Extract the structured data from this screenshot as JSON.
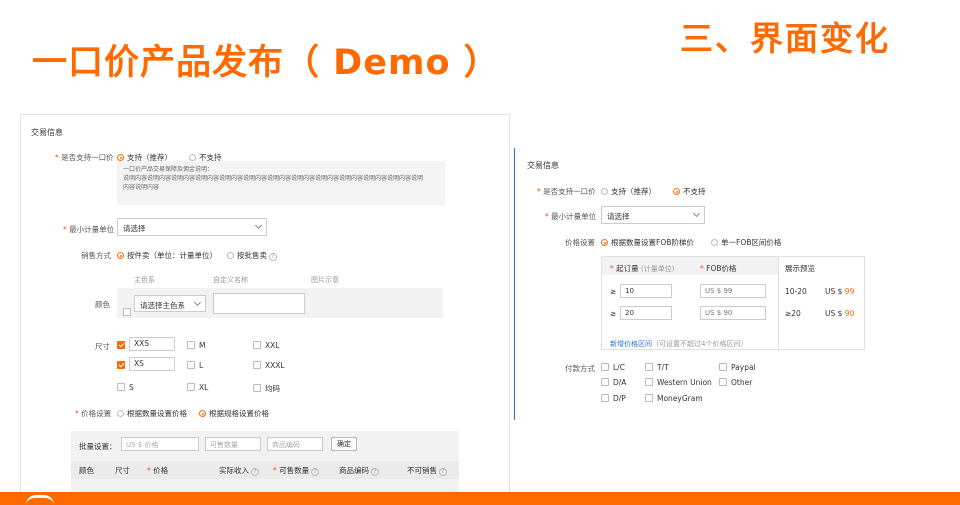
{
  "slide": {
    "title": "一口价产品发布（ Demo ）",
    "heading": "三、界面变化"
  },
  "left": {
    "section_title": "交易信息",
    "fixed_price": {
      "label": "是否支持一口价",
      "opt_yes": "支持（推荐）",
      "opt_no": "不支持",
      "notice_lines": [
        "一口价产品交易保障及佣金说明：",
        "说明内容说明内容说明内容说明内容说明内容说明内容说明内容说明内容说明内容说明内容说明内容说明内容说明",
        "内容说明内容"
      ]
    },
    "min_unit": {
      "label": "最小计量单位",
      "value": "请选择"
    },
    "sale_mode": {
      "label": "销售方式",
      "opt_piece": "按件卖（单位：计量单位）",
      "opt_batch": "按批售卖"
    },
    "attr_headers": {
      "main_color": "主色系",
      "custom_name": "自定义名称",
      "image": "图片示意"
    },
    "color": {
      "label": "颜色",
      "select_value": "请选择主色系"
    },
    "size": {
      "label": "尺寸",
      "items": [
        {
          "label": "XXS",
          "checked": true,
          "boxed": true
        },
        {
          "label": "M",
          "checked": false,
          "boxed": false
        },
        {
          "label": "XXL",
          "checked": false,
          "boxed": false
        },
        {
          "label": "XS",
          "checked": true,
          "boxed": true
        },
        {
          "label": "L",
          "checked": false,
          "boxed": false
        },
        {
          "label": "XXXL",
          "checked": false,
          "boxed": false
        },
        {
          "label": "S",
          "checked": false,
          "boxed": false
        },
        {
          "label": "XL",
          "checked": false,
          "boxed": false
        },
        {
          "label": "均码",
          "checked": false,
          "boxed": false
        }
      ]
    },
    "price_setting": {
      "label": "价格设置",
      "opt_qty": "根据数量设置价格",
      "opt_spec": "根据规格设置价格"
    },
    "batch": {
      "label": "批量设置：",
      "price_ph": "US $ 价格",
      "qty_ph": "可售数量",
      "code_ph": "商品编码",
      "confirm": "确定"
    },
    "table_headers": [
      "颜色",
      "尺寸",
      "价格",
      "实际收入",
      "可售数量",
      "商品编码",
      "不可销售"
    ]
  },
  "right": {
    "section_title": "交易信息",
    "fixed_price": {
      "label": "是否支持一口价",
      "opt_yes": "支持（推荐）",
      "opt_no": "不支持"
    },
    "min_unit": {
      "label": "最小计量单位",
      "value": "请选择"
    },
    "price_setting": {
      "label": "价格设置",
      "opt_fob_tier": "根据数量设置FOB阶梯价",
      "opt_fob_single": "单一FOB区间价格"
    },
    "tiers": {
      "min_order_label": "起订量",
      "min_order_unit": "(计量单位)",
      "fob_label": "FOB价格",
      "preview_label": "展示预览",
      "rows": [
        {
          "sign": "≥",
          "qty": "10",
          "price": "US $ 99",
          "preview_range": "10-20",
          "preview_prefix": "US $",
          "preview_value": "99"
        },
        {
          "sign": "≥",
          "qty": "20",
          "price": "US $ 90",
          "preview_range": "≥20",
          "preview_prefix": "US $",
          "preview_value": "90"
        }
      ],
      "add_link": "新增价格区间",
      "add_note": "（可设置不超过4个价格区间）"
    },
    "payment": {
      "label": "付款方式",
      "options": [
        "L/C",
        "T/T",
        "Paypal",
        "D/A",
        "Western Union",
        "Other",
        "D/P",
        "MoneyGram"
      ]
    }
  }
}
